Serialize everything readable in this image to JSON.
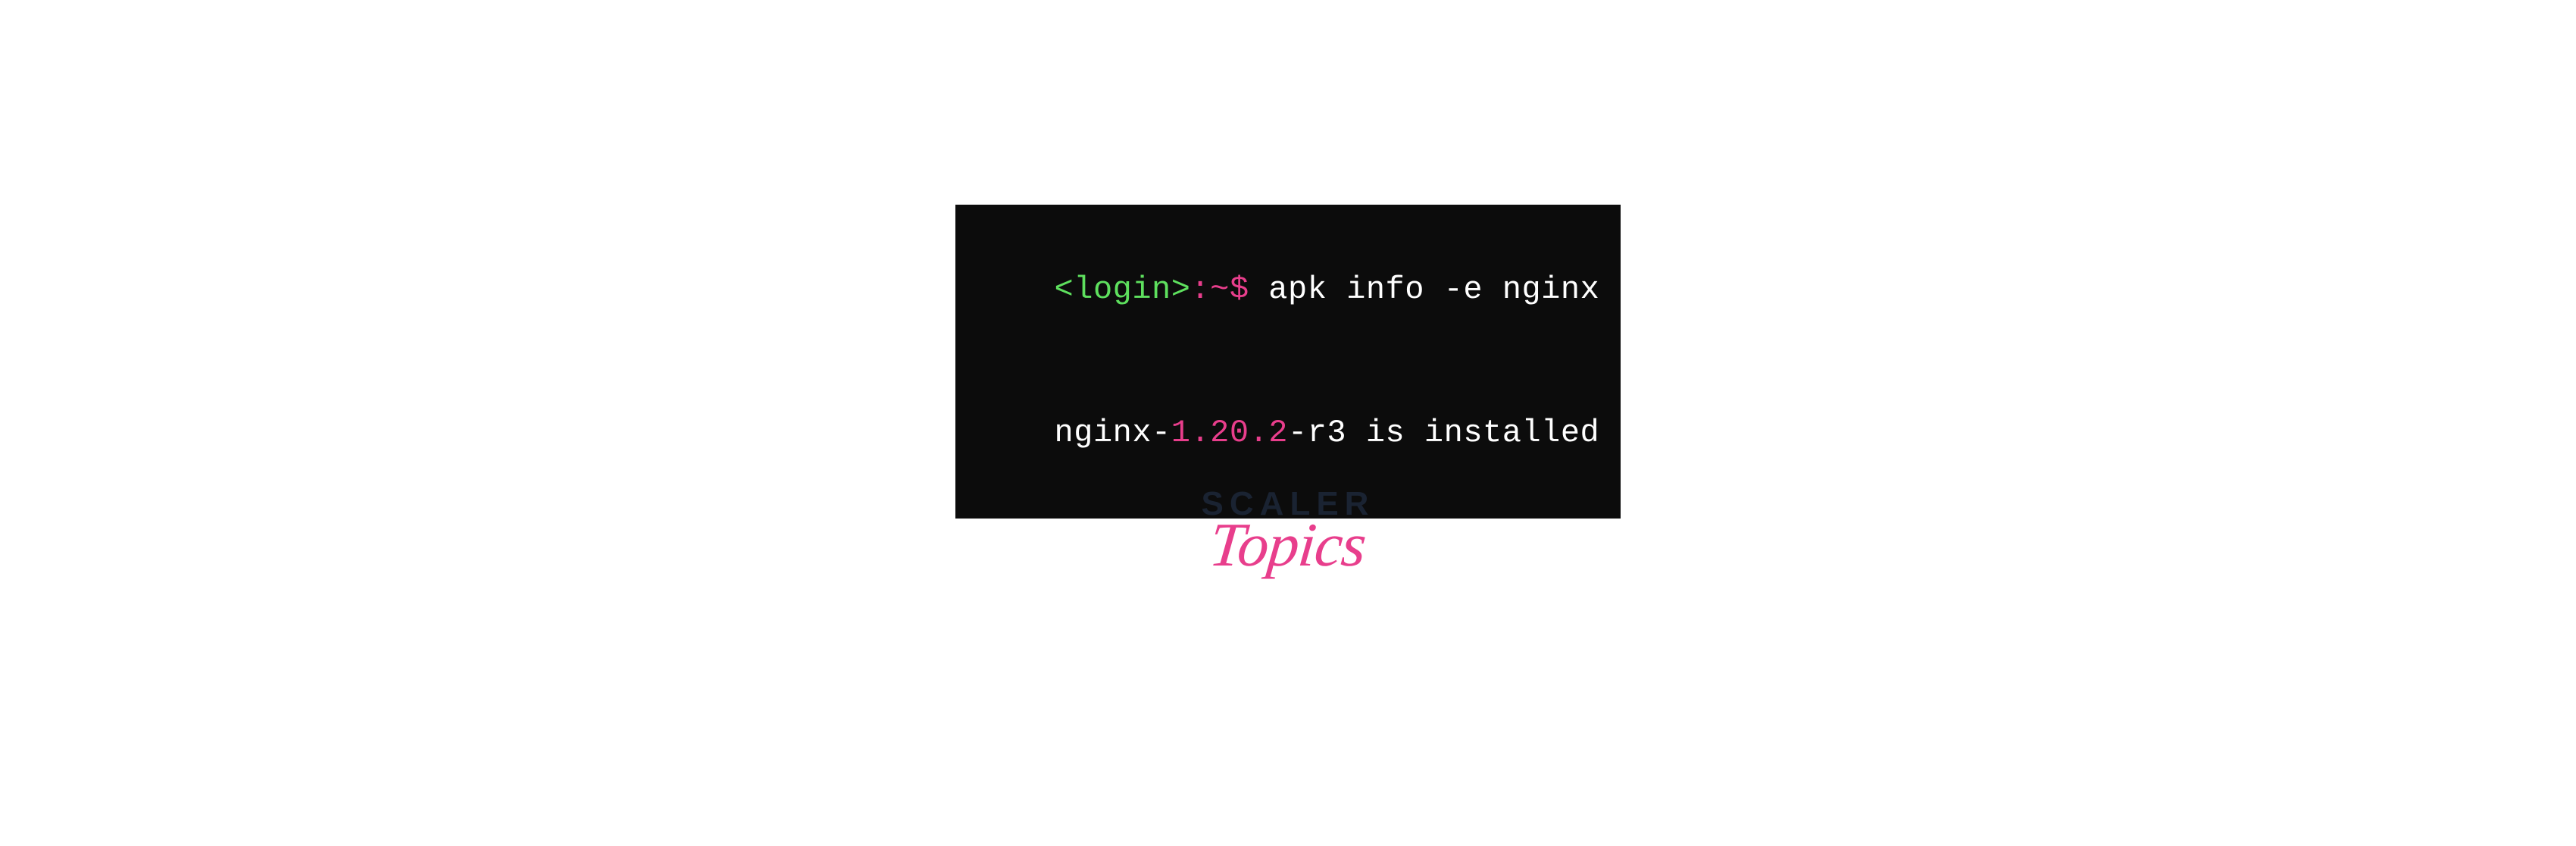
{
  "terminal": {
    "prompt": {
      "login": "<login>",
      "colon": ":",
      "tilde_dollar": "~$",
      "sep_join": ":~$"
    },
    "command": " apk info -e nginx",
    "output": {
      "prefix": "nginx-",
      "version": "1.20.2",
      "suffix": "-r3 is installed"
    }
  },
  "logo": {
    "scaler": "SCALER",
    "topics": "Topics"
  },
  "colors": {
    "terminal_bg": "#0c0c0c",
    "green": "#5ee05e",
    "pink": "#e83e8c",
    "white": "#ffffff",
    "dark_navy": "#1a2332"
  }
}
